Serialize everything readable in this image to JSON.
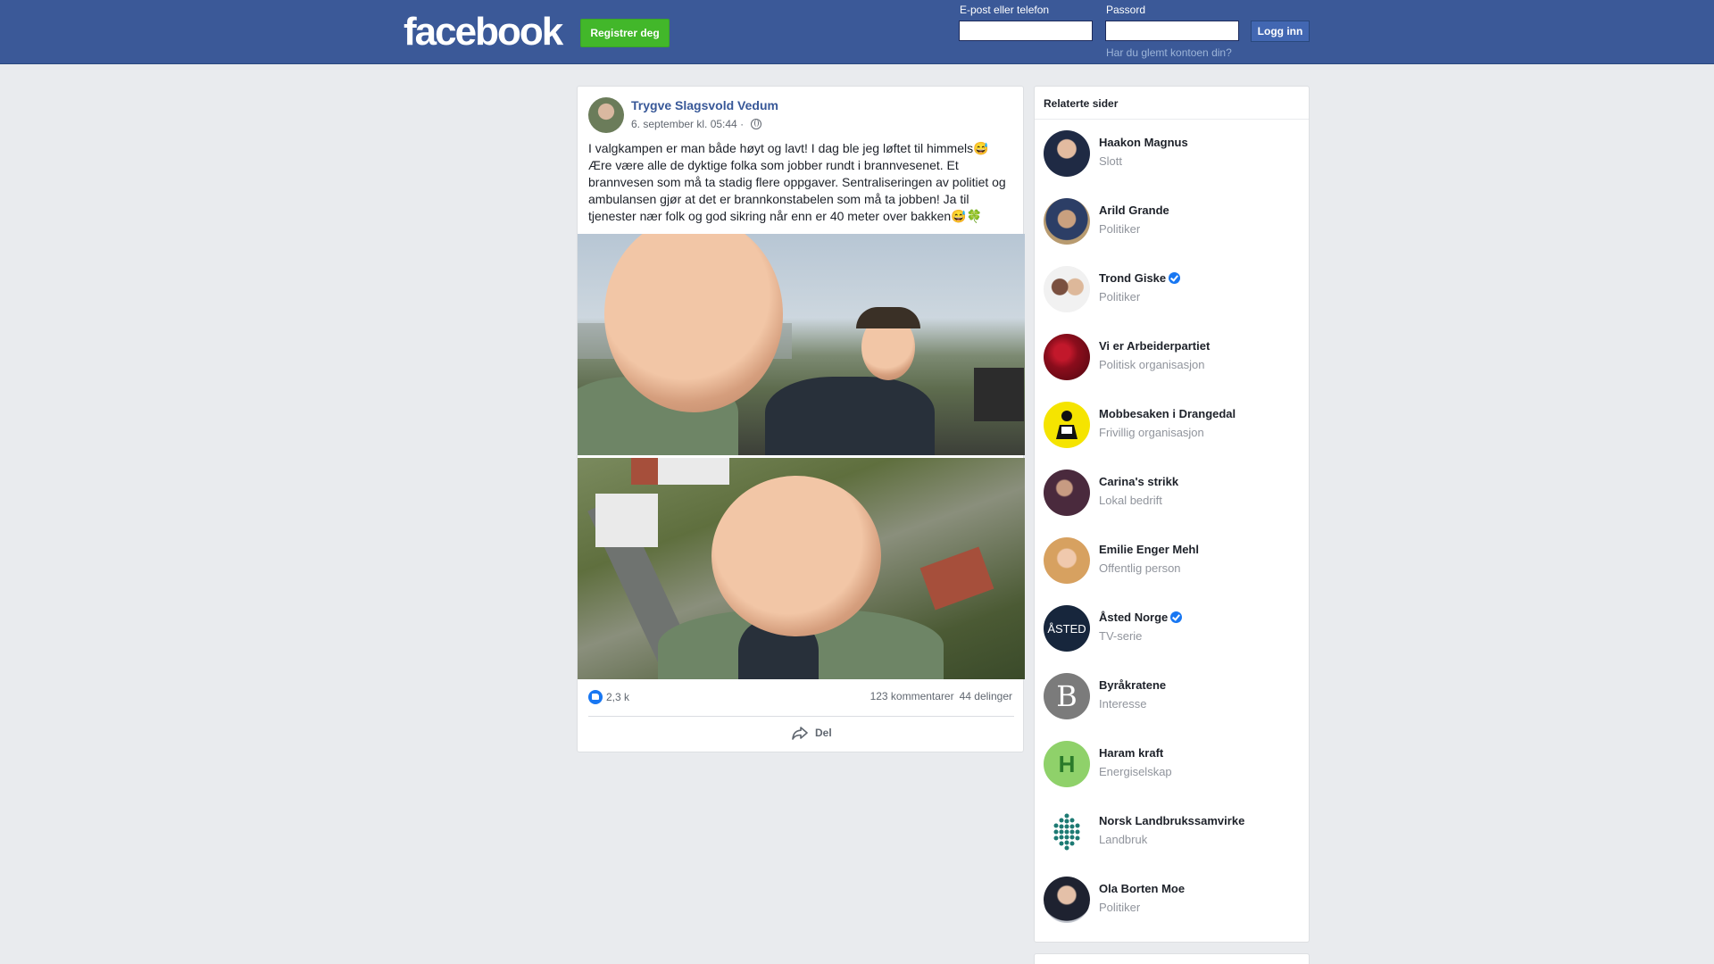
{
  "header": {
    "logo": "facebook",
    "register_label": "Registrer deg",
    "email_label": "E-post eller telefon",
    "password_label": "Passord",
    "login_label": "Logg inn",
    "forgot_label": "Har du glemt kontoen din?",
    "email_value": "",
    "password_value": ""
  },
  "post": {
    "author": "Trygve Slagsvold Vedum",
    "timestamp": "6. september kl. 05:44 ·",
    "text_lines": [
      "I valgkampen er man både høyt og lavt! I dag ble jeg løftet til himmels😅",
      "Ære være alle de dyktige folka som jobber rundt i brannvesenet. Et",
      "brannvesen som må ta stadig flere oppgaver. Sentraliseringen av politiet og",
      "ambulansen gjør at det er brannkonstabelen som må ta jobben! Ja til",
      "tjenester nær folk og god sikring når enn er 40 meter over bakken😅🍀"
    ],
    "likes": "2,3 k",
    "comments": "123 kommentarer",
    "shares": "44 delinger",
    "share_label": "Del",
    "accent_color": "#385898"
  },
  "related": {
    "title": "Relaterte sider",
    "items": [
      {
        "name": "Haakon Magnus",
        "category": "Slott",
        "verified": false
      },
      {
        "name": "Arild Grande",
        "category": "Politiker",
        "verified": false
      },
      {
        "name": "Trond Giske",
        "category": "Politiker",
        "verified": true
      },
      {
        "name": "Vi er Arbeiderpartiet",
        "category": "Politisk organisasjon",
        "verified": false
      },
      {
        "name": "Mobbesaken i Drangedal",
        "category": "Frivillig organisasjon",
        "verified": false
      },
      {
        "name": "Carina's strikk",
        "category": "Lokal bedrift",
        "verified": false
      },
      {
        "name": "Emilie Enger Mehl",
        "category": "Offentlig person",
        "verified": false
      },
      {
        "name": "Åsted Norge",
        "category": "TV-serie",
        "verified": true
      },
      {
        "name": "Byråkratene",
        "category": "Interesse",
        "verified": false
      },
      {
        "name": "Haram kraft",
        "category": "Energiselskap",
        "verified": false
      },
      {
        "name": "Norsk Landbrukssamvirke",
        "category": "Landbruk",
        "verified": false
      },
      {
        "name": "Ola Borten Moe",
        "category": "Politiker",
        "verified": false
      }
    ],
    "avatar_letters": {
      "asted": "ÅSTED",
      "byrakratene": "B",
      "haram": "H"
    }
  }
}
